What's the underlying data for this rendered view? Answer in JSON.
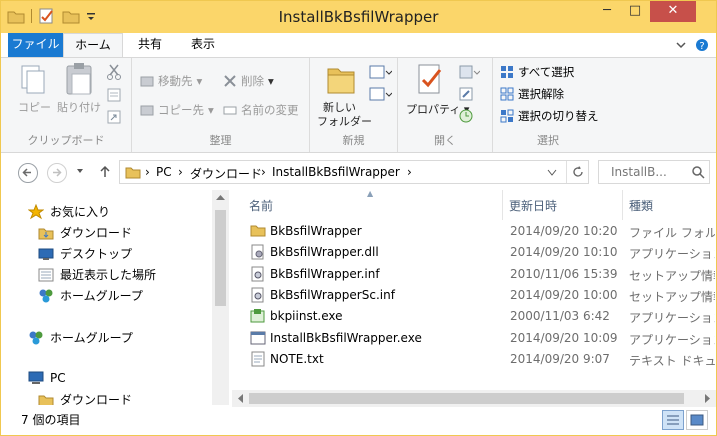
{
  "title": "InstallBkBsfilWrapper",
  "window_controls": {
    "minimize": "─",
    "maximize": "□",
    "close": "✕"
  },
  "ribbon_tabs": [
    {
      "label": "ファイル"
    },
    {
      "label": "ホーム"
    },
    {
      "label": "共有"
    },
    {
      "label": "表示"
    }
  ],
  "ribbon": {
    "clipboard": {
      "label": "クリップボード",
      "copy": "コピー",
      "paste": "貼り付け"
    },
    "organize": {
      "label": "整理",
      "move_to": "移動先",
      "copy_to": "コピー先",
      "delete": "削除",
      "rename": "名前の変更"
    },
    "new": {
      "label": "新規",
      "new_folder_line1": "新しい",
      "new_folder_line2": "フォルダー"
    },
    "open": {
      "label": "開く",
      "properties": "プロパティ"
    },
    "select": {
      "label": "選択",
      "select_all": "すべて選択",
      "select_none": "選択解除",
      "invert": "選択の切り替え"
    }
  },
  "address": {
    "segments": [
      "PC",
      "ダウンロード",
      "InstallBkBsfilWrapper"
    ],
    "search_placeholder": "InstallB..."
  },
  "nav_pane": {
    "items": [
      {
        "label": "お気に入り",
        "icon": "star-icon"
      },
      {
        "label": "ダウンロード",
        "icon": "folder-icon"
      },
      {
        "label": "デスクトップ",
        "icon": "desktop-icon"
      },
      {
        "label": "最近表示した場所",
        "icon": "recent-places-icon"
      },
      {
        "label": "ホームグループ",
        "icon": "homegroup-icon"
      },
      {
        "label": "ホームグループ",
        "icon": "homegroup-icon"
      },
      {
        "label": "PC",
        "icon": "pc-icon"
      },
      {
        "label": "ダウンロード",
        "icon": "folder-icon"
      }
    ]
  },
  "columns": {
    "name": "名前",
    "date": "更新日時",
    "type": "種類"
  },
  "files": [
    {
      "name": "BkBsfilWrapper",
      "date": "2014/09/20 10:20",
      "type": "ファイル フォルダー",
      "icon": "folder-icon"
    },
    {
      "name": "BkBsfilWrapper.dll",
      "date": "2014/09/20 10:10",
      "type": "アプリケーション拡張",
      "icon": "dll-icon"
    },
    {
      "name": "BkBsfilWrapper.inf",
      "date": "2010/11/06 15:39",
      "type": "セットアップ情報",
      "icon": "inf-icon"
    },
    {
      "name": "BkBsfilWrapperSc.inf",
      "date": "2014/09/20 10:00",
      "type": "セットアップ情報",
      "icon": "inf-icon"
    },
    {
      "name": "bkpiinst.exe",
      "date": "2000/11/03 6:42",
      "type": "アプリケーション",
      "icon": "installer-exe-icon"
    },
    {
      "name": "InstallBkBsfilWrapper.exe",
      "date": "2014/09/20 10:09",
      "type": "アプリケーション",
      "icon": "exe-icon"
    },
    {
      "name": "NOTE.txt",
      "date": "2014/09/20 9:07",
      "type": "テキスト ドキュメント",
      "icon": "text-file-icon"
    }
  ],
  "status": {
    "item_count": "7 個の項目"
  },
  "colors": {
    "title_bar": "#fbd66a",
    "file_tab": "#1a7ad2",
    "close_button": "#c7504a",
    "folder": "#e8c15a"
  }
}
